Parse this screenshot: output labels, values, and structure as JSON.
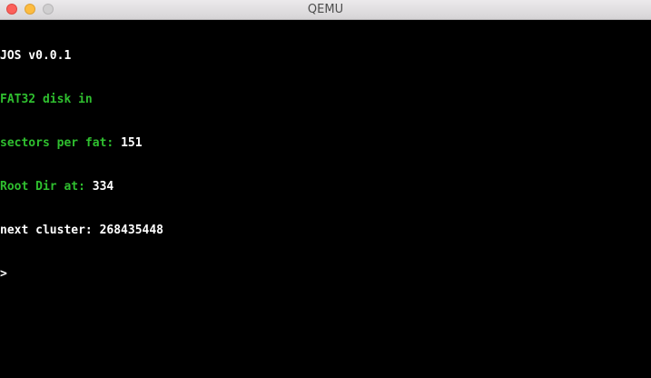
{
  "window": {
    "title": "QEMU"
  },
  "console": {
    "line1": "JOS v0.0.1",
    "line2": "FAT32 disk in",
    "line3_label": "sectors per fat: ",
    "line3_value": "151",
    "line4_label": "Root Dir at: ",
    "line4_value": "334",
    "line5": "next cluster: 268435448",
    "prompt": ">"
  },
  "colors": {
    "text_white": "#ffffff",
    "text_green": "#2fbf2f",
    "background": "#000000"
  },
  "icons": {
    "close": "close-button",
    "minimize": "minimize-button",
    "zoom": "zoom-button"
  }
}
